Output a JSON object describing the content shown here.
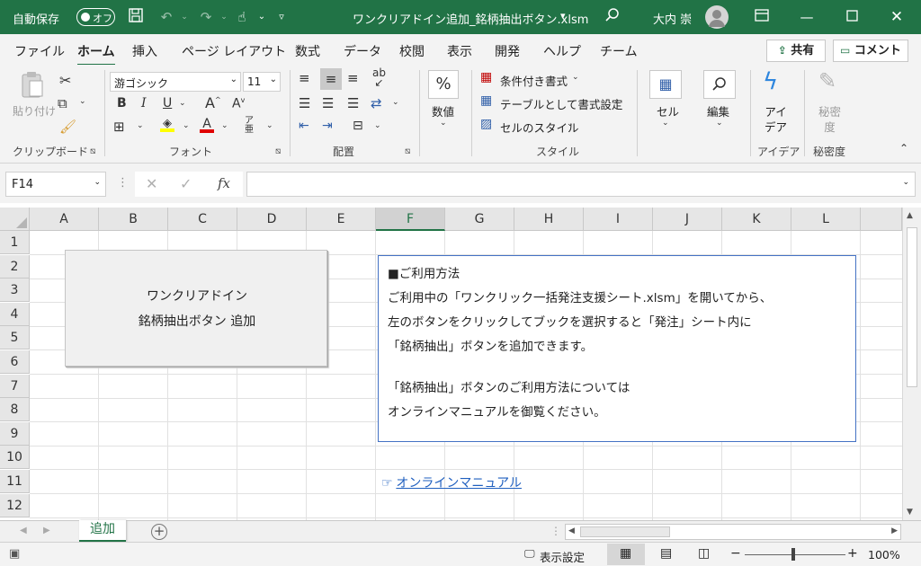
{
  "titlebar": {
    "autosave_label": "自動保存",
    "autosave_state": "オフ",
    "filename": "ワンクリアドイン追加_銘柄抽出ボタン.xlsm",
    "dropdown": "▾",
    "user": "大内 崇"
  },
  "tabs": [
    "ファイル",
    "ホーム",
    "挿入",
    "ページ レイアウト",
    "数式",
    "データ",
    "校閲",
    "表示",
    "開発",
    "ヘルプ",
    "チーム"
  ],
  "active_tab": "ホーム",
  "share_label": "共有",
  "comment_label": "コメント",
  "ribbon": {
    "paste_label": "貼り付け",
    "font_name": "游ゴシック",
    "font_size": "11",
    "conditional_format": "条件付き書式",
    "format_as_table": "テーブルとして書式設定",
    "cell_styles": "セルのスタイル",
    "number_label": "数値",
    "cells_label": "セル",
    "editing_label": "編集",
    "ideas_label_1": "アイ",
    "ideas_label_2": "デア",
    "sensitivity_label_1": "秘密",
    "sensitivity_label_2": "度",
    "groups": {
      "clipboard": "クリップボード",
      "font": "フォント",
      "alignment": "配置",
      "styles": "スタイル",
      "ideas": "アイデア",
      "sensitivity": "秘密度"
    }
  },
  "namebox": "F14",
  "formula": "",
  "fx_label": "fx",
  "columns": [
    "A",
    "B",
    "C",
    "D",
    "E",
    "F",
    "G",
    "H",
    "I",
    "J",
    "K",
    "L"
  ],
  "rows": [
    "1",
    "2",
    "3",
    "4",
    "5",
    "6",
    "7",
    "8",
    "9",
    "10",
    "11",
    "12"
  ],
  "selected_column": "F",
  "button": {
    "line1": "ワンクリアドイン",
    "line2": "銘柄抽出ボタン 追加"
  },
  "instructions": {
    "heading": "■ご利用方法",
    "line1": "ご利用中の「ワンクリック一括発注支援シート.xlsm」を開いてから、",
    "line2": "左のボタンをクリックしてブックを選択すると「発注」シート内に",
    "line3": "「銘柄抽出」ボタンを追加できます。",
    "line4": "「銘柄抽出」ボタンのご利用方法については",
    "line5": "オンラインマニュアルを御覧ください。"
  },
  "manual_link": "オンラインマニュアル",
  "sheet_tab": "追加",
  "status": {
    "display_settings": "表示設定",
    "zoom": "100%",
    "zoom_minus": "−",
    "zoom_plus": "+"
  },
  "colors": {
    "excel_green": "#217346",
    "link_blue": "#1f5fbf",
    "textbox_border": "#4472c4"
  }
}
